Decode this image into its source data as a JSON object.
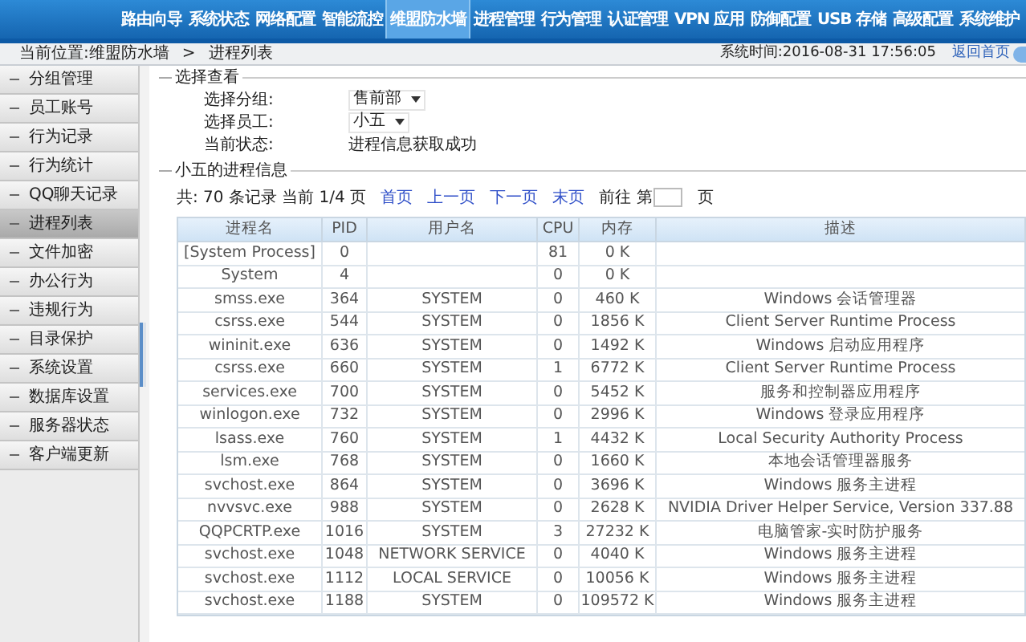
{
  "nav": [
    {
      "label": "路由向导",
      "selected": false
    },
    {
      "label": "系统状态",
      "selected": false
    },
    {
      "label": "网络配置",
      "selected": false
    },
    {
      "label": "智能流控",
      "selected": false
    },
    {
      "label": "维盟防水墙",
      "selected": true
    },
    {
      "label": "进程管理",
      "selected": false
    },
    {
      "label": "行为管理",
      "selected": false
    },
    {
      "label": "认证管理",
      "selected": false
    },
    {
      "label": "VPN 应用",
      "selected": false
    },
    {
      "label": "防御配置",
      "selected": false
    },
    {
      "label": "USB 存储",
      "selected": false
    },
    {
      "label": "高级配置",
      "selected": false
    },
    {
      "label": "系统维护",
      "selected": false
    }
  ],
  "breadcrumb": {
    "location": "当前位置:维盟防水墙",
    "separator": ">",
    "page": "进程列表",
    "system_time": "系统时间:2016-08-31 17:56:05",
    "home_link": "返回首页"
  },
  "sidebar": {
    "items": [
      {
        "label": "分组管理",
        "selected": false
      },
      {
        "label": "员工账号",
        "selected": false
      },
      {
        "label": "行为记录",
        "selected": false
      },
      {
        "label": "行为统计",
        "selected": false
      },
      {
        "label": "QQ聊天记录",
        "selected": false
      },
      {
        "label": "进程列表",
        "selected": true
      },
      {
        "label": "文件加密",
        "selected": false
      },
      {
        "label": "办公行为",
        "selected": false
      },
      {
        "label": "违规行为",
        "selected": false
      },
      {
        "label": "目录保护",
        "selected": false
      },
      {
        "label": "系统设置",
        "selected": false
      },
      {
        "label": "数据库设置",
        "selected": false
      },
      {
        "label": "服务器状态",
        "selected": false
      },
      {
        "label": "客户端更新",
        "selected": false
      }
    ]
  },
  "select_section": {
    "legend": "选择查看",
    "fields": [
      {
        "kind": "dropdown",
        "label": "选择分组:",
        "value": "售前部"
      },
      {
        "kind": "dropdown",
        "label": "选择员工:",
        "value": "小五"
      },
      {
        "kind": "text",
        "label": "当前状态:",
        "value": "进程信息获取成功"
      }
    ]
  },
  "process_section": {
    "legend": "小五的进程信息",
    "pagination": {
      "summary": "共: 70 条记录 当前 1/4 页",
      "links": [
        "首页",
        "上一页",
        "下一页",
        "末页"
      ],
      "goto_prefix": "前往 第",
      "goto_suffix": "页"
    },
    "table": {
      "columns": [
        "进程名",
        "PID",
        "用户名",
        "CPU",
        "内存",
        "描述"
      ],
      "rows": [
        [
          "[System Process]",
          "0",
          "",
          "81",
          "0 K",
          ""
        ],
        [
          "System",
          "4",
          "",
          "0",
          "0 K",
          ""
        ],
        [
          "smss.exe",
          "364",
          "SYSTEM",
          "0",
          "460 K",
          "Windows 会话管理器"
        ],
        [
          "csrss.exe",
          "544",
          "SYSTEM",
          "0",
          "1856 K",
          "Client Server Runtime Process"
        ],
        [
          "wininit.exe",
          "636",
          "SYSTEM",
          "0",
          "1492 K",
          "Windows 启动应用程序"
        ],
        [
          "csrss.exe",
          "660",
          "SYSTEM",
          "1",
          "6772 K",
          "Client Server Runtime Process"
        ],
        [
          "services.exe",
          "700",
          "SYSTEM",
          "0",
          "5452 K",
          "服务和控制器应用程序"
        ],
        [
          "winlogon.exe",
          "732",
          "SYSTEM",
          "0",
          "2996 K",
          "Windows 登录应用程序"
        ],
        [
          "lsass.exe",
          "760",
          "SYSTEM",
          "1",
          "4432 K",
          "Local Security Authority Process"
        ],
        [
          "lsm.exe",
          "768",
          "SYSTEM",
          "0",
          "1660 K",
          "本地会话管理器服务"
        ],
        [
          "svchost.exe",
          "864",
          "SYSTEM",
          "0",
          "3696 K",
          "Windows 服务主进程"
        ],
        [
          "nvvsvc.exe",
          "988",
          "SYSTEM",
          "0",
          "2628 K",
          "NVIDIA Driver Helper Service, Version 337.88"
        ],
        [
          "QQPCRTP.exe",
          "1016",
          "SYSTEM",
          "3",
          "27232 K",
          "电脑管家-实时防护服务"
        ],
        [
          "svchost.exe",
          "1048",
          "NETWORK SERVICE",
          "0",
          "4040 K",
          "Windows 服务主进程"
        ],
        [
          "svchost.exe",
          "1112",
          "LOCAL SERVICE",
          "0",
          "10056 K",
          "Windows 服务主进程"
        ],
        [
          "svchost.exe",
          "1188",
          "SYSTEM",
          "0",
          "109572 K",
          "Windows 服务主进程"
        ]
      ]
    }
  }
}
